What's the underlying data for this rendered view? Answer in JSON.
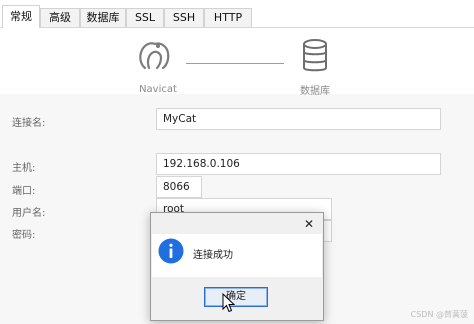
{
  "tabs": [
    {
      "label": "常规",
      "active": true
    },
    {
      "label": "高级"
    },
    {
      "label": "数据库"
    },
    {
      "label": "SSL"
    },
    {
      "label": "SSH"
    },
    {
      "label": "HTTP"
    }
  ],
  "header": {
    "left_label": "Navicat",
    "right_label": "数据库"
  },
  "form": {
    "connection_name_label": "连接名:",
    "connection_name": "MyCat",
    "host_label": "主机:",
    "host": "192.168.0.106",
    "port_label": "端口:",
    "port": "8066",
    "username_label": "用户名:",
    "username": "root",
    "password_label": "密码:"
  },
  "dialog": {
    "close_symbol": "✕",
    "message": "连接成功",
    "ok_label": "确定"
  },
  "watermark": "CSDN @茼蒿菠",
  "colors": {
    "accent": "#2a6fce",
    "info_icon": "#1f6fe0"
  }
}
